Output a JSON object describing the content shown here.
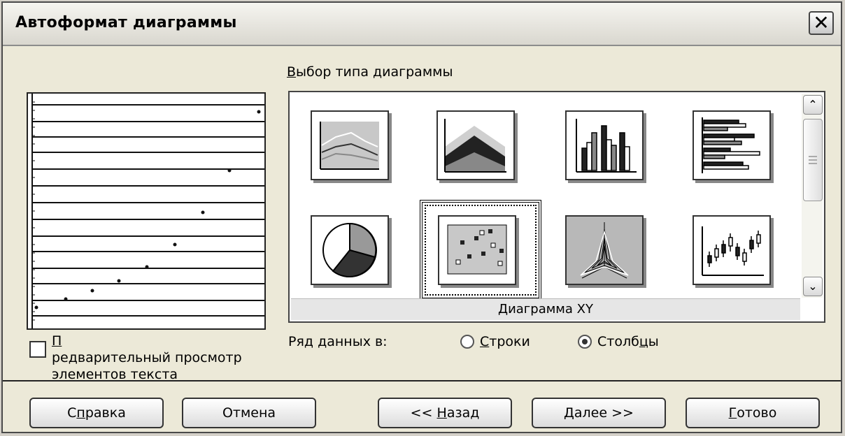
{
  "window": {
    "title": "Автоформат диаграммы",
    "close_glyph": "✕"
  },
  "gallery": {
    "section_title": "Выбор типа диаграммы",
    "selected_caption": "Диаграмма XY",
    "selected_type": "xy",
    "types": [
      {
        "name": "line",
        "icon": "line-chart-icon"
      },
      {
        "name": "area",
        "icon": "area-chart-icon"
      },
      {
        "name": "column",
        "icon": "column-chart-icon"
      },
      {
        "name": "bar",
        "icon": "bar-chart-icon"
      },
      {
        "name": "pie",
        "icon": "pie-chart-icon"
      },
      {
        "name": "xy",
        "icon": "xy-scatter-chart-icon"
      },
      {
        "name": "net",
        "icon": "net-chart-icon"
      },
      {
        "name": "stock",
        "icon": "stock-chart-icon"
      }
    ],
    "scroll_up_glyph": "⌃",
    "scroll_down_glyph": "⌄"
  },
  "preview": {
    "checkbox_label_line1": "Предварительный просмотр",
    "checkbox_label_line2": "элементов текста",
    "checkbox_checked": false
  },
  "series": {
    "label": "Ряд данных в:",
    "options": [
      {
        "label": "Строки",
        "selected": false
      },
      {
        "label": "Столбцы",
        "selected": true
      }
    ]
  },
  "buttons": {
    "help": "Справка",
    "cancel": "Отмена",
    "back": "<< Назад",
    "next": "Далее >>",
    "finish": "Готово"
  },
  "colors": {
    "dialog_bg": "#ece9d8",
    "preview_bg": "#ffffff",
    "chart_fill": "#c8c8c8"
  }
}
